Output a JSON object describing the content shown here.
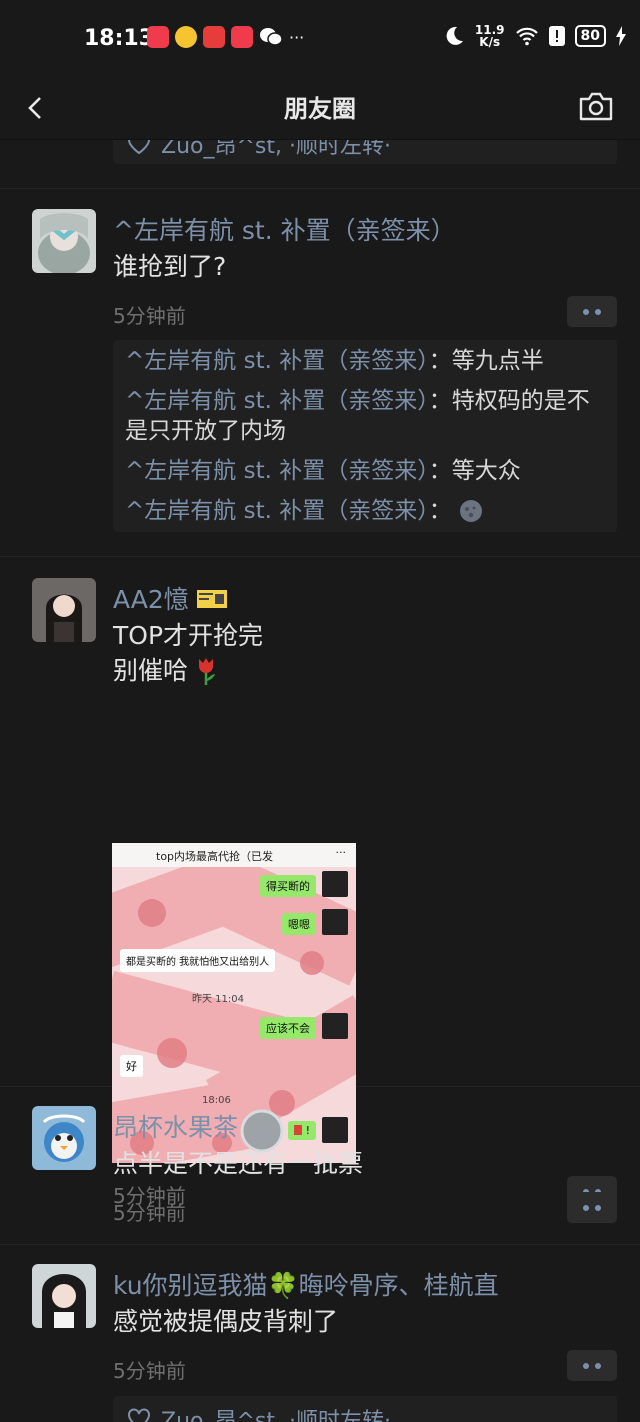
{
  "status_bar": {
    "time": "18:13",
    "net_speed_value": "11.9",
    "net_speed_unit": "K/s",
    "battery": "80",
    "more": "···"
  },
  "header": {
    "title": "朋友圈"
  },
  "top_partial_likes": "Zuo_昂^st, ·顺时左转·",
  "posts": [
    {
      "nickname": "^左岸有航 st. 补置（亲签来）",
      "content": "谁抢到了?",
      "time": "5分钟前",
      "comments": [
        {
          "name": "^左岸有航 st. 补置（亲签来）",
          "text": "：等九点半"
        },
        {
          "name": "^左岸有航 st. 补置（亲签来）",
          "text": "：特权码的是不是只开放了内场"
        },
        {
          "name": "^左岸有航 st. 补置（亲签来）",
          "text": "：等大众"
        },
        {
          "name": "^左岸有航 st. 补置（亲签来）",
          "text": "："
        }
      ]
    },
    {
      "nickname": "AA2憶",
      "content_line1": "TOP才开抢完",
      "content_line2": "别催哈",
      "time": "5分钟前",
      "screenshot": {
        "title": "top内场最高代抢（已发",
        "menu": "···",
        "msg1": "得买断的",
        "msg2": "嗯嗯",
        "msg3": "都是买断的 我就怕他又出给别人",
        "time1": "昨天 11:04",
        "msg4": "应该不会",
        "msg5": "好",
        "time2": "18:06",
        "msg6": "!"
      }
    },
    {
      "nickname": "昂杯水果茶",
      "content": "点半是不是还有一批票",
      "time": "5分钟前"
    },
    {
      "nickname": "ku你别逗我猫🍀晦呤骨序、桂航直",
      "content": "感觉被提偶皮背刺了",
      "time": "5分钟前",
      "likes": "Zuo_昂^st, ·顺时左转·"
    }
  ]
}
